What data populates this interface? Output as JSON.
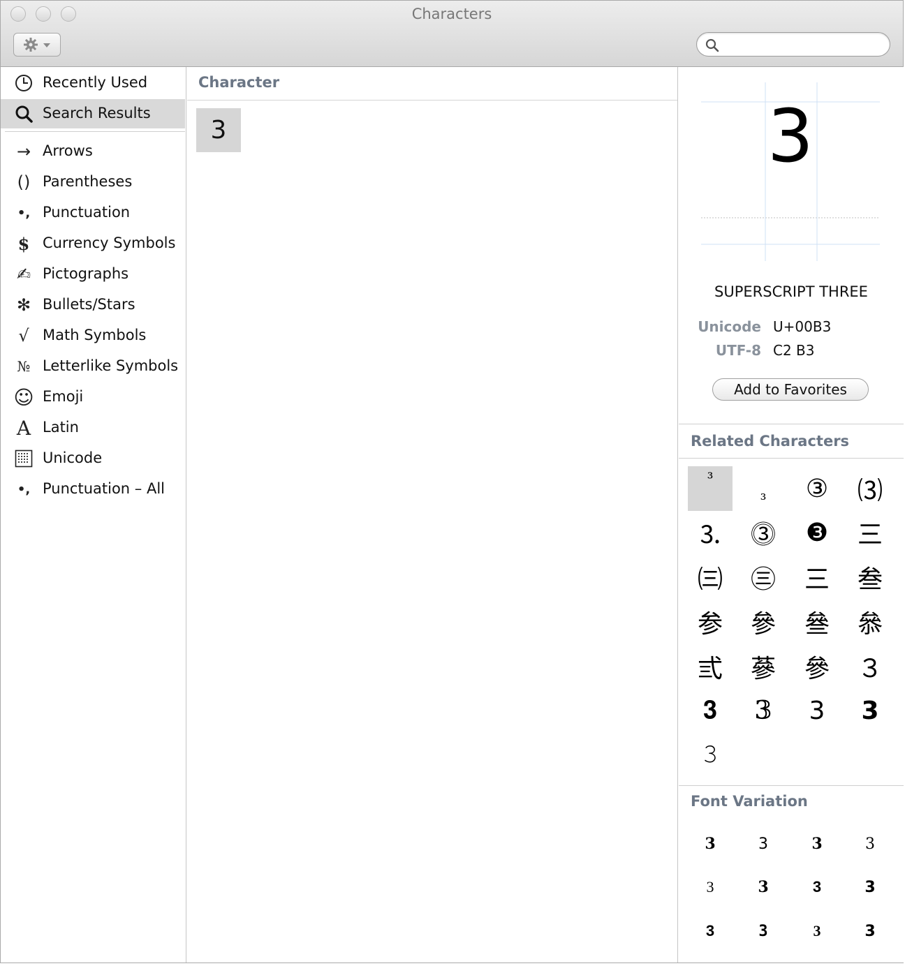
{
  "window": {
    "title": "Characters"
  },
  "search": {
    "value": "",
    "placeholder": ""
  },
  "sidebar": {
    "items": [
      {
        "label": "Recently Used",
        "icon": "clock-icon",
        "glyph": ""
      },
      {
        "label": "Search Results",
        "icon": "magnifier-icon",
        "glyph": ""
      },
      {
        "label": "Arrows",
        "icon": "arrow-icon",
        "glyph": "→"
      },
      {
        "label": "Parentheses",
        "icon": "parentheses-icon",
        "glyph": "()"
      },
      {
        "label": "Punctuation",
        "icon": "punctuation-icon",
        "glyph": "•,"
      },
      {
        "label": "Currency Symbols",
        "icon": "dollar-icon",
        "glyph": "$"
      },
      {
        "label": "Pictographs",
        "icon": "writing-hand-icon",
        "glyph": "✍"
      },
      {
        "label": "Bullets/Stars",
        "icon": "asterisk-icon",
        "glyph": "✻"
      },
      {
        "label": "Math Symbols",
        "icon": "square-root-icon",
        "glyph": "√"
      },
      {
        "label": "Letterlike Symbols",
        "icon": "numero-icon",
        "glyph": "№"
      },
      {
        "label": "Emoji",
        "icon": "smiley-icon",
        "glyph": "☺"
      },
      {
        "label": "Latin",
        "icon": "letter-a-icon",
        "glyph": "A"
      },
      {
        "label": "Unicode",
        "icon": "grid-icon",
        "glyph": ""
      },
      {
        "label": "Punctuation – All",
        "icon": "punctuation-icon",
        "glyph": "•,"
      }
    ]
  },
  "center": {
    "header": "Character",
    "result": "3"
  },
  "inspector": {
    "glyph": "3",
    "name": "SUPERSCRIPT THREE",
    "unicode_label": "Unicode",
    "unicode_value": "U+00B3",
    "utf8_label": "UTF-8",
    "utf8_value": "C2 B3",
    "fav_button": "Add to Favorites"
  },
  "related": {
    "header": "Related Characters",
    "chars": [
      "³",
      "₃",
      "③",
      "⑶",
      "⒊",
      "⓷",
      "❸",
      "三",
      "㈢",
      "㊂",
      "三",
      "叁",
      "参",
      "參",
      "叄",
      "叅",
      "弎",
      "蔘",
      "參",
      "３",
      "𝟑",
      "𝟛",
      "𝟥",
      "𝟯",
      "𝟹"
    ]
  },
  "font_variation": {
    "header": "Font Variation",
    "chars": [
      "3",
      "3",
      "3",
      "3",
      "3",
      "3",
      "3",
      "3",
      "3",
      "3",
      "3",
      "3"
    ]
  }
}
